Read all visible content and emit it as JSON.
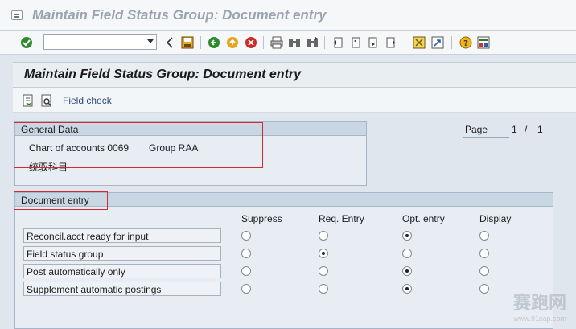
{
  "window": {
    "title": "Maintain Field Status Group: Document entry"
  },
  "toolbar": {
    "command_field_value": "",
    "icons": [
      "enter-check-icon",
      "back-arrow-icon",
      "save-icon",
      "back-icon",
      "exit-icon",
      "cancel-icon",
      "print-icon",
      "find-icon",
      "find-next-icon",
      "first-page-icon",
      "previous-page-icon",
      "next-page-icon",
      "last-page-icon",
      "create-session-icon",
      "shortcut-icon",
      "help-icon",
      "layout-menu-icon"
    ]
  },
  "screen": {
    "title": "Maintain Field Status Group: Document entry",
    "app_toolbar": {
      "field_check_label": "Field check"
    }
  },
  "general_data": {
    "title": "General Data",
    "chart_of_accounts": "Chart of accounts 0069",
    "group": "Group RAA",
    "description": "统驭科目"
  },
  "paging": {
    "label": "Page",
    "current": "1",
    "separator": "/",
    "total": "1"
  },
  "document_entry": {
    "title": "Document entry",
    "columns": [
      "Suppress",
      "Req. Entry",
      "Opt. entry",
      "Display"
    ],
    "rows": [
      {
        "label": "Reconcil.acct ready for input",
        "selected": "Opt. entry"
      },
      {
        "label": "Field status group",
        "selected": "Req. Entry"
      },
      {
        "label": "Post automatically only",
        "selected": "Opt. entry"
      },
      {
        "label": "Supplement automatic postings",
        "selected": "Opt. entry"
      }
    ]
  },
  "watermark": {
    "text": "赛跑网",
    "url": "www.91sap.com"
  }
}
